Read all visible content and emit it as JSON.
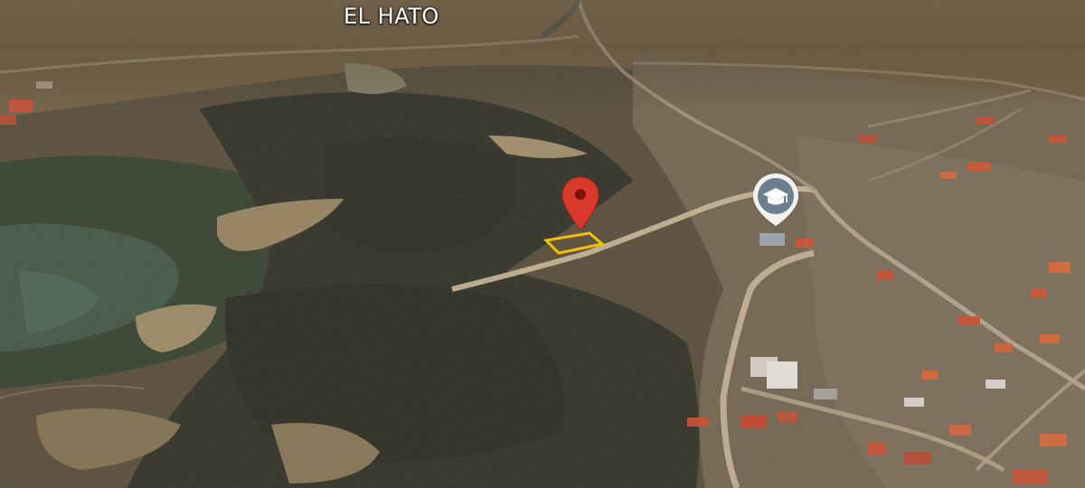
{
  "map": {
    "place_label": "EL HATO",
    "markers": [
      {
        "id": "location-pin",
        "icon": "map-pin-icon",
        "color": "#d93a2b"
      },
      {
        "id": "school-marker",
        "icon": "graduation-cap-icon",
        "color": "#6b7f8f"
      }
    ],
    "highlight": {
      "id": "property-plot",
      "color": "#f2c200"
    }
  }
}
